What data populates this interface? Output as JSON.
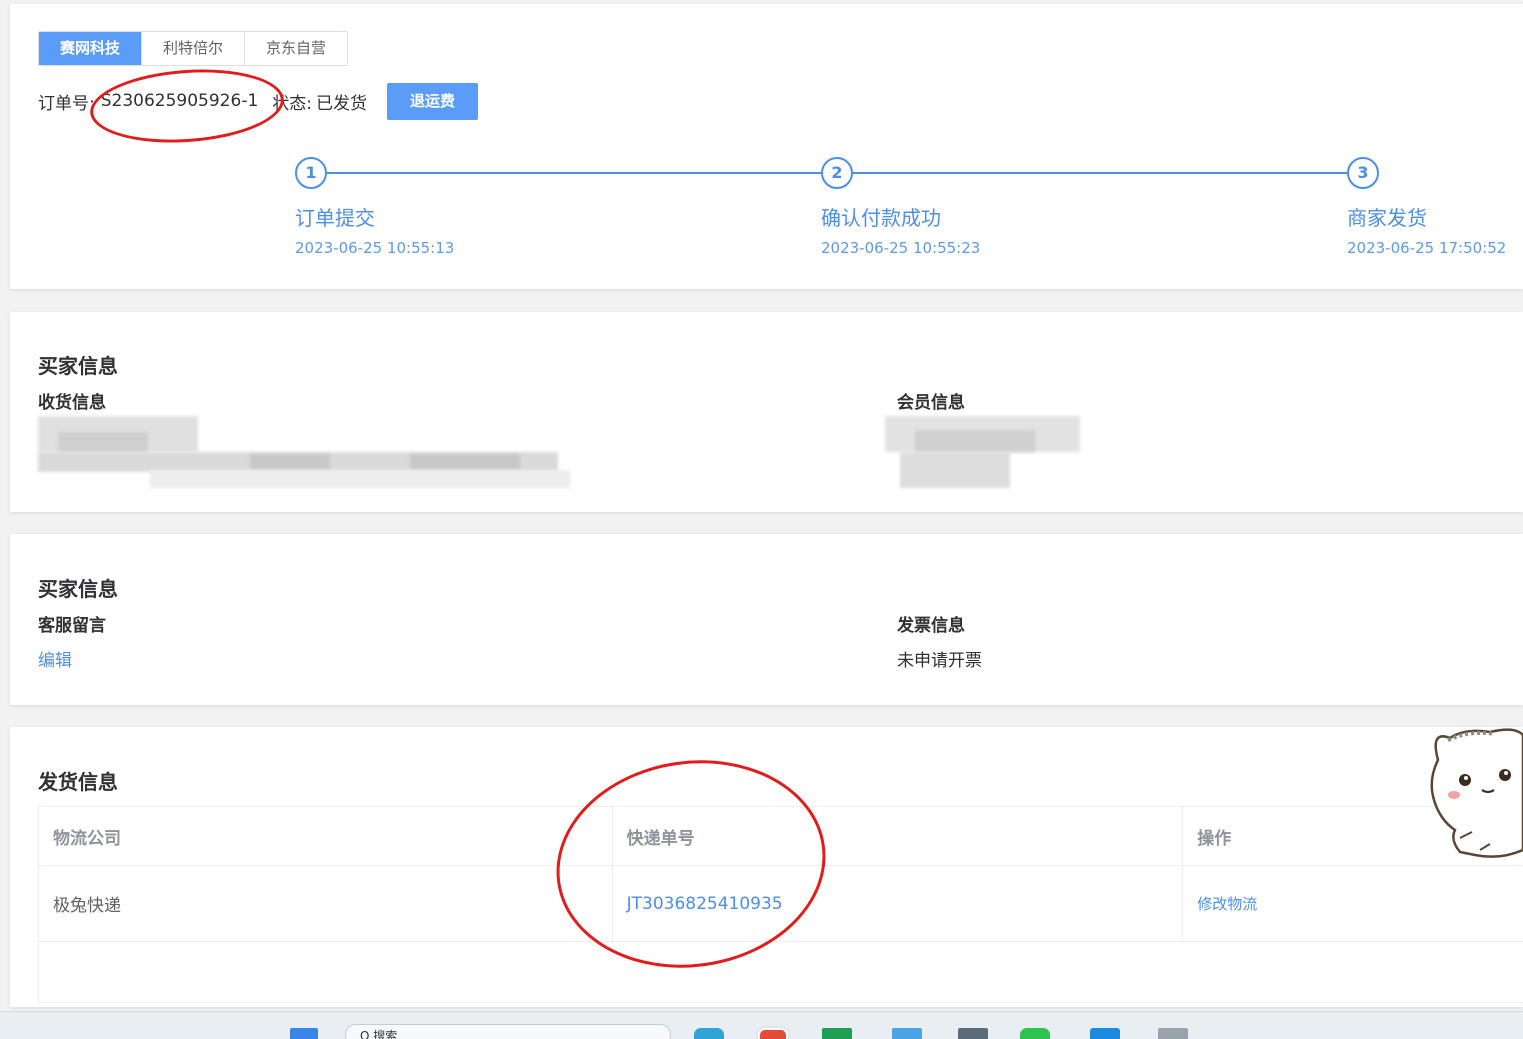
{
  "shop_tabs": [
    "赛网科技",
    "利特倍尔",
    "京东自营"
  ],
  "order": {
    "label": "订单号:",
    "number": "S230625905926-1",
    "status_label": "状态:",
    "status_value": "已发货",
    "refund_button": "退运费"
  },
  "steps": [
    {
      "index": "1",
      "title": "订单提交",
      "time": "2023-06-25 10:55:13"
    },
    {
      "index": "2",
      "title": "确认付款成功",
      "time": "2023-06-25 10:55:23"
    },
    {
      "index": "3",
      "title": "商家发货",
      "time": "2023-06-25 17:50:52"
    }
  ],
  "buyer": {
    "title": "买家信息",
    "receive_label": "收货信息",
    "member_label": "会员信息"
  },
  "service": {
    "title": "买家信息",
    "note_label": "客服留言",
    "note_edit": "编辑",
    "invoice_label": "发票信息",
    "invoice_value": "未申请开票"
  },
  "shipping": {
    "title": "发货信息",
    "columns": [
      "物流公司",
      "快递单号",
      "操作"
    ],
    "rows": [
      {
        "company": "极兔快递",
        "tracking": "JT3036825410935",
        "action": "修改物流"
      }
    ]
  },
  "colors": {
    "accent": "#5a9cf8",
    "step_blue": "#4c8fe6",
    "annotation_red": "#e41b1b"
  },
  "taskbar": {
    "search_placeholder": "Q 搜索"
  }
}
